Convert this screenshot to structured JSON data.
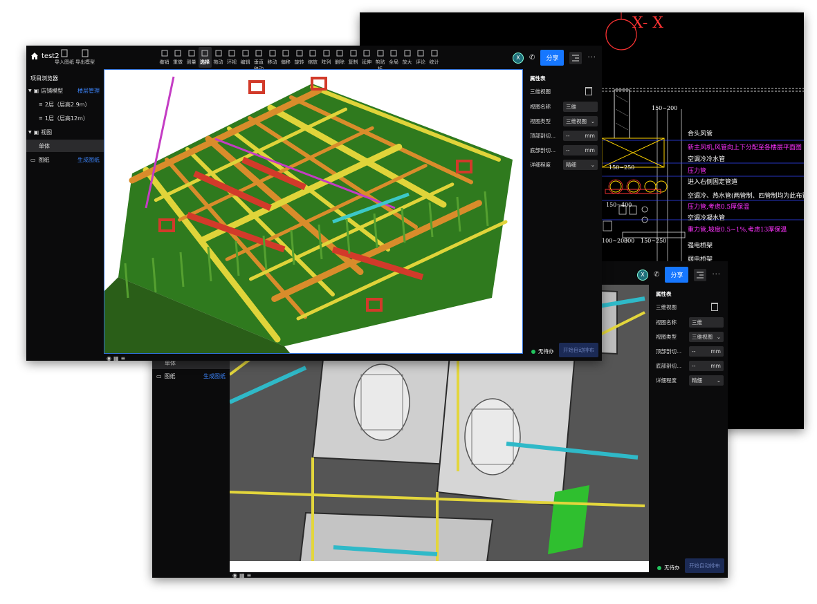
{
  "front": {
    "project_name": "test2",
    "header_buttons": [
      "导入图纸",
      "导出模型"
    ],
    "tools": [
      "撤销",
      "重做",
      "测量",
      "选择",
      "拖动",
      "环视",
      "编辑",
      "垂直移动",
      "移动",
      "偏移",
      "旋转",
      "缩放",
      "阵列",
      "删除",
      "复制",
      "延伸",
      "剪贴板",
      "全局",
      "放大",
      "评论",
      "统计"
    ],
    "active_tool": "选择",
    "avatar_letter": "X",
    "share_label": "分享",
    "more_label": "···",
    "browser": {
      "title": "项目浏览器",
      "model": "店铺模型",
      "model_link": "楼层管理",
      "floors": [
        "2层（层高2.9m）",
        "1层（层高12m）"
      ],
      "views_label": "视图",
      "view_item": "单体",
      "drawings_label": "图纸",
      "drawings_link": "生成图纸"
    },
    "props": {
      "title": "属性表",
      "subtitle": "三维视图",
      "rows": [
        {
          "label": "视图名称",
          "value": "三维",
          "suffix": ""
        },
        {
          "label": "视图类型",
          "value": "三维视图",
          "suffix": "⌄"
        },
        {
          "label": "顶部剖切...",
          "value": "--",
          "suffix": "mm"
        },
        {
          "label": "底部剖切...",
          "value": "--",
          "suffix": "mm"
        },
        {
          "label": "详细程度",
          "value": "精细",
          "suffix": "⌄"
        }
      ]
    },
    "status": "无待办",
    "sort_button": "开始自动排布"
  },
  "back": {
    "avatar_letter": "X",
    "share_label": "分享",
    "more_label": "···",
    "view_item": "单体",
    "drawings_label": "图纸",
    "drawings_link": "生成图纸",
    "props": {
      "title": "属性表",
      "subtitle": "三维视图",
      "rows": [
        {
          "label": "视图名称",
          "value": "三维",
          "suffix": ""
        },
        {
          "label": "视图类型",
          "value": "三维视图",
          "suffix": "⌄"
        },
        {
          "label": "顶部剖切...",
          "value": "--",
          "suffix": "mm"
        },
        {
          "label": "底部剖切...",
          "value": "--",
          "suffix": "mm"
        },
        {
          "label": "详细程度",
          "value": "精细",
          "suffix": "⌄"
        }
      ]
    },
    "status": "无待办",
    "sort_button": "开始自动排布"
  },
  "cad": {
    "section_label": "X- X",
    "dims": [
      "150~200",
      "150~250",
      "150~400",
      "100~200",
      "300",
      "150~250"
    ],
    "notes": [
      {
        "text": "合头风管",
        "color": "#ffffff"
      },
      {
        "text": "新主风机,风管向上下分配至各楼层平面图",
        "color": "#ff33ff"
      },
      {
        "text": "空调冷冷水管",
        "color": "#ffffff"
      },
      {
        "text": "压力管",
        "color": "#ff33ff"
      },
      {
        "text": "进入右侧固定管道",
        "color": "#ffffff"
      },
      {
        "text": "空调冷、热水管(两管制、四管制均为此布置原则)",
        "color": "#ffffff"
      },
      {
        "text": "压力管,考虑0.5厚保温",
        "color": "#ff33ff"
      },
      {
        "text": "空调冷凝水管",
        "color": "#ffffff"
      },
      {
        "text": "重力管,坡度0.5~1%,考虑13厚保温",
        "color": "#ff33ff"
      },
      {
        "text": "强电桥架",
        "color": "#ffffff"
      },
      {
        "text": "弱电桥架",
        "color": "#ffffff"
      }
    ]
  }
}
